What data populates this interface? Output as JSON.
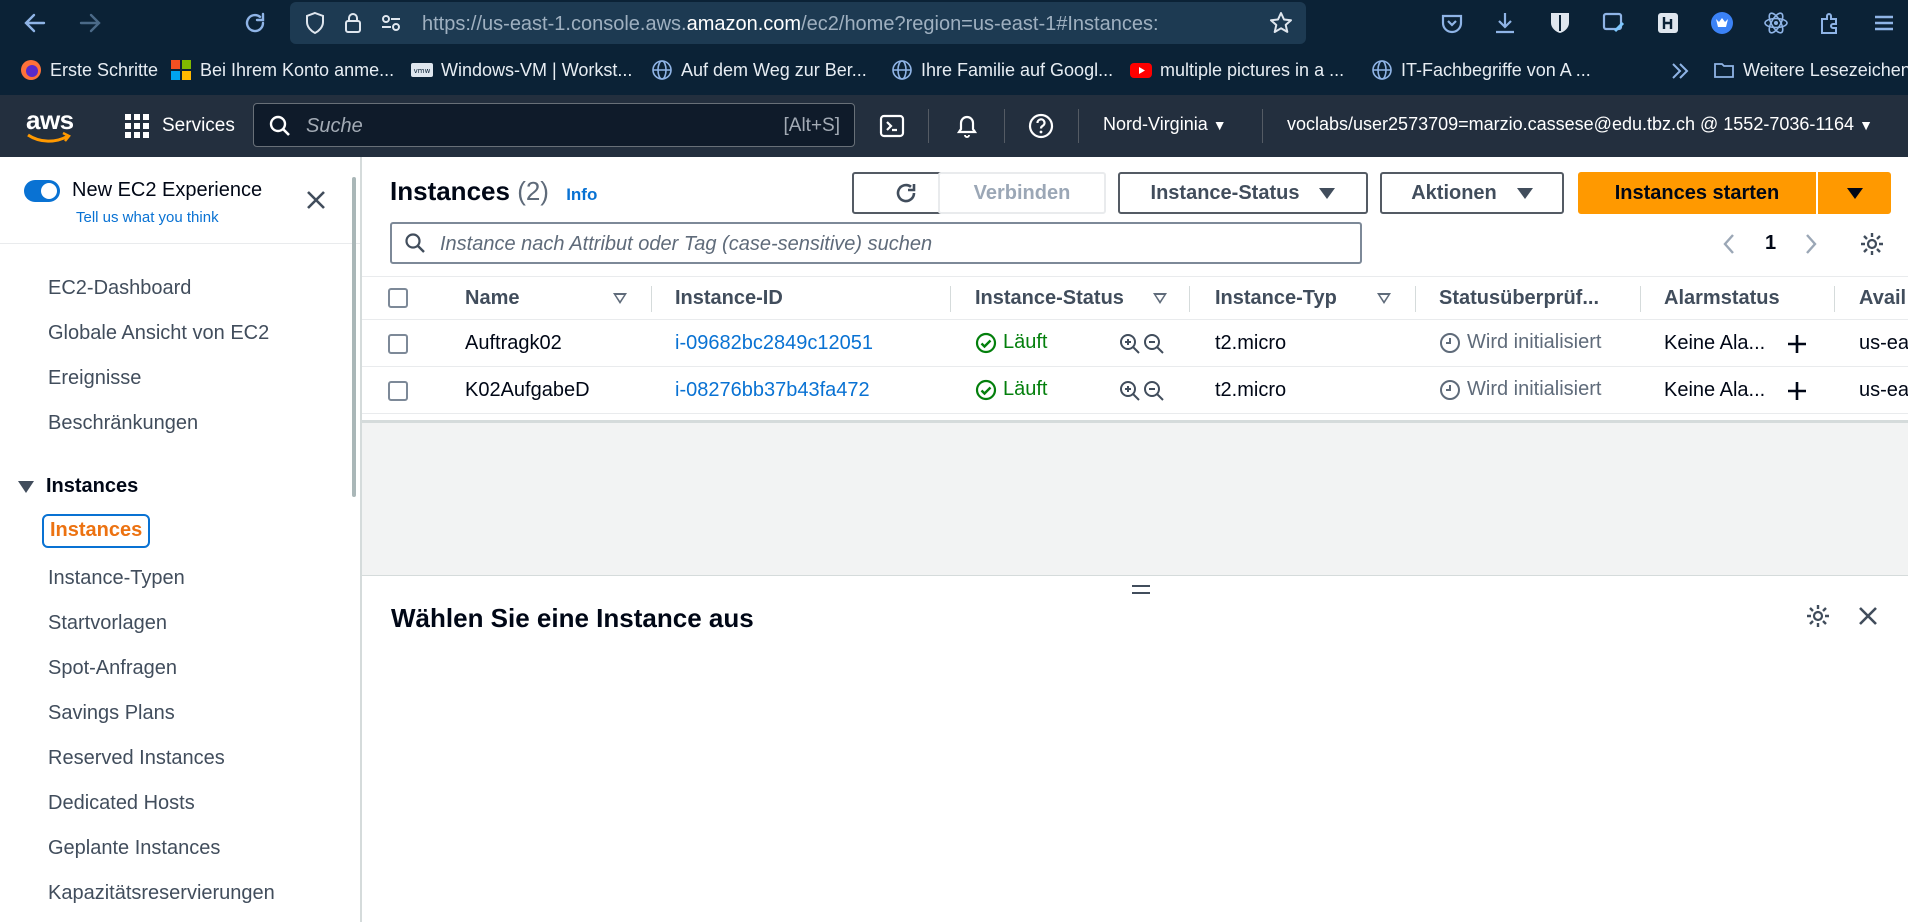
{
  "browser": {
    "url_prefix": "https://us-east-1.console.aws.",
    "url_domain": "amazon.com",
    "url_suffix": "/ec2/home?region=us-east-1#Instances:"
  },
  "bookmarks": [
    {
      "label": "Erste Schritte",
      "icon": "firefox-icon"
    },
    {
      "label": "Bei Ihrem Konto anme...",
      "icon": "microsoft-icon"
    },
    {
      "label": "Windows-VM | Workst...",
      "icon": "vmware-icon"
    },
    {
      "label": "Auf dem Weg zur Ber...",
      "icon": "globe-icon"
    },
    {
      "label": "Ihre Familie auf Googl...",
      "icon": "globe-icon"
    },
    {
      "label": "multiple pictures in a ...",
      "icon": "youtube-icon"
    },
    {
      "label": "IT-Fachbegriffe von A ...",
      "icon": "globe-icon"
    }
  ],
  "bookmarks_more": "Weitere Lesezeichen",
  "aws": {
    "logo": "aws",
    "services": "Services",
    "search_placeholder": "Suche",
    "search_shortcut": "[Alt+S]",
    "region": "Nord-Virginia",
    "account": "voclabs/user2573709=marzio.cassese@edu.tbz.ch @ 1552-7036-1164"
  },
  "sidebar": {
    "new_experience": "New EC2 Experience",
    "tell_us": "Tell us what you think",
    "top_items": [
      "EC2-Dashboard",
      "Globale Ansicht von EC2",
      "Ereignisse",
      "Beschränkungen"
    ],
    "section": "Instances",
    "active_item": "Instances",
    "section_items": [
      "Instance-Typen",
      "Startvorlagen",
      "Spot-Anfragen",
      "Savings Plans",
      "Reserved Instances",
      "Dedicated Hosts",
      "Geplante Instances",
      "Kapazitätsreservierungen"
    ]
  },
  "main": {
    "title": "Instances",
    "count": "(2)",
    "info": "Info",
    "btn_connect": "Verbinden",
    "btn_state": "Instance-Status",
    "btn_actions": "Aktionen",
    "btn_launch": "Instances starten",
    "filter_placeholder": "Instance nach Attribut oder Tag (case-sensitive) suchen",
    "page": "1",
    "columns": [
      "Name",
      "Instance-ID",
      "Instance-Status",
      "Instance-Typ",
      "Statusüberprüf...",
      "Alarmstatus",
      "Avail"
    ],
    "rows": [
      {
        "name": "Auftragk02",
        "id": "i-09682bc2849c12051",
        "state": "Läuft",
        "type": "t2.micro",
        "check": "Wird initialisiert",
        "alarm": "Keine Ala...",
        "az": "us-ea"
      },
      {
        "name": "K02AufgabeD",
        "id": "i-08276bb37b43fa472",
        "state": "Läuft",
        "type": "t2.micro",
        "check": "Wird initialisiert",
        "alarm": "Keine Ala...",
        "az": "us-ea"
      }
    ],
    "detail_title": "Wählen Sie eine Instance aus"
  },
  "colors": {
    "accent": "#ff9900",
    "link": "#0972d3",
    "success": "#037f0c",
    "nav": "#232f3e"
  }
}
